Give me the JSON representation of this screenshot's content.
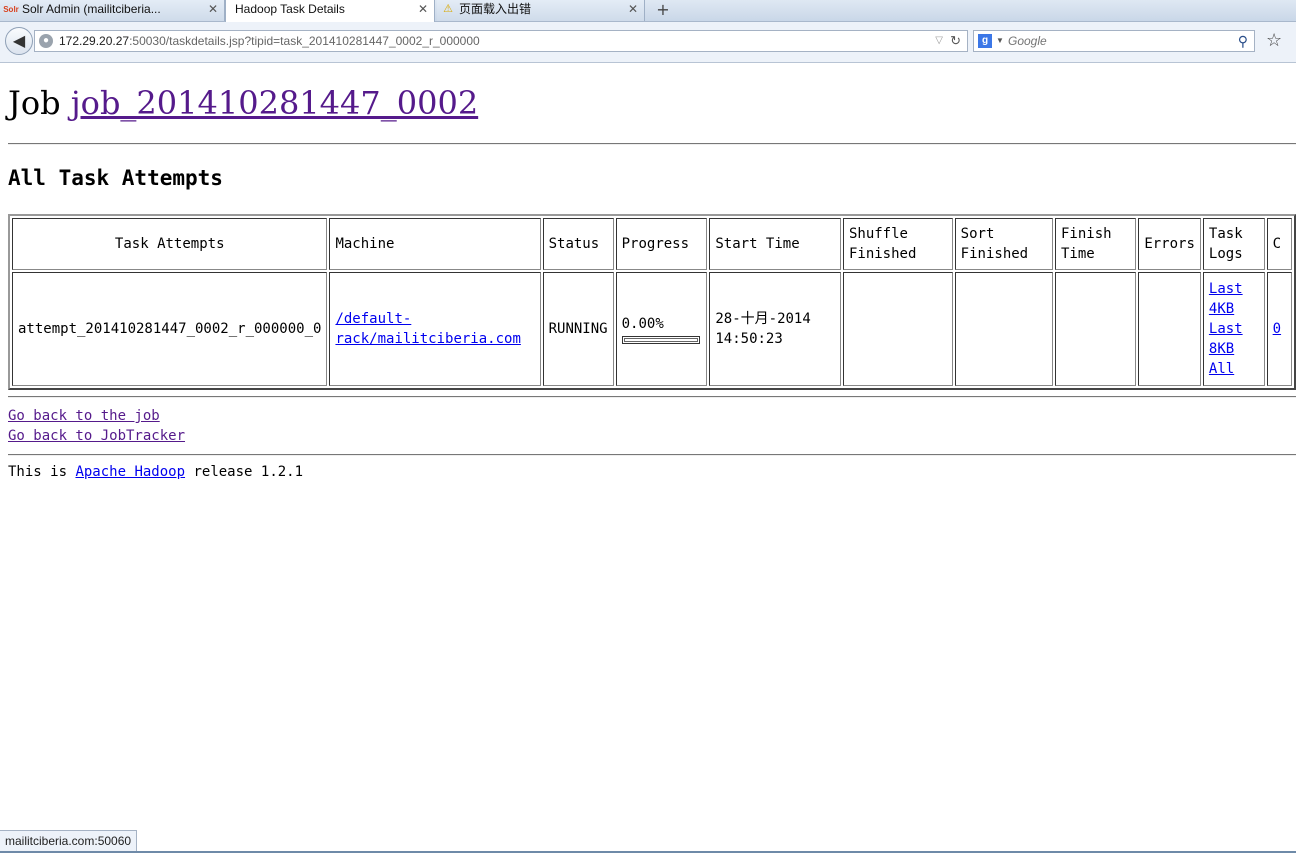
{
  "browser": {
    "tabs": [
      {
        "title": "Solr Admin (mailitciberia...",
        "icon": "solr-icon",
        "icon_text": "Solr"
      },
      {
        "title": "Hadoop Task Details",
        "icon": ""
      },
      {
        "title": "页面载入出错",
        "icon": "warning-icon"
      }
    ],
    "url_host": "172.29.20.27",
    "url_rest": ":50030/taskdetails.jsp?tipid=task_201410281447_0002_r_000000",
    "search_placeholder": "Google",
    "search_engine_letter": "g",
    "status_text": "mailitciberia.com:50060"
  },
  "page": {
    "job_prefix": "Job",
    "job_link": "job_201410281447_0002",
    "section_title": "All Task Attempts",
    "table": {
      "headers": [
        "Task Attempts",
        "Machine",
        "Status",
        "Progress",
        "Start Time",
        "Shuffle Finished",
        "Sort Finished",
        "Finish Time",
        "Errors",
        "Task Logs",
        "C"
      ],
      "rows": [
        {
          "attempt": "attempt_201410281447_0002_r_000000_0",
          "machine": "/default-rack/mailitciberia.com",
          "status": "RUNNING",
          "progress_text": "0.00%",
          "progress_fraction": 0.0,
          "start_time": "28-十月-2014 14:50:23",
          "shuffle_finished": "",
          "sort_finished": "",
          "finish_time": "",
          "errors": "",
          "task_logs": [
            "Last 4KB",
            "Last 8KB",
            "All"
          ],
          "counters": "0"
        }
      ]
    },
    "back_to_job": "Go back to the job",
    "back_to_jobtracker": "Go back to JobTracker",
    "footer_prefix": "This is",
    "footer_link": "Apache Hadoop",
    "footer_suffix": "release 1.2.1"
  }
}
